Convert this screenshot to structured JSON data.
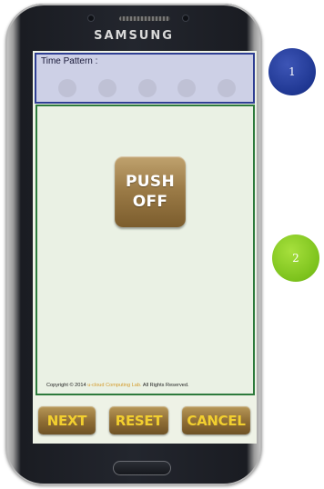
{
  "device": {
    "brand": "SAMSUNG"
  },
  "screen": {
    "time_pattern": {
      "label": "Time Pattern :",
      "dot_count": 5
    },
    "push_button": {
      "line1": "PUSH",
      "line2": "OFF"
    },
    "copyright": {
      "prefix": "Copyright © 2014",
      "lab": "u-cloud Computing Lab.",
      "suffix": "All Rights Reserved."
    },
    "buttons": {
      "next": "NEXT",
      "reset": "RESET",
      "cancel": "CANCEL"
    }
  },
  "callouts": {
    "one": "1",
    "two": "2"
  },
  "colors": {
    "time_panel_border": "#2e3e93",
    "main_panel_border": "#2d7a3c",
    "button_text": "#f2cf2f",
    "callout_1": "#1f3792",
    "callout_2": "#7cc21c"
  }
}
